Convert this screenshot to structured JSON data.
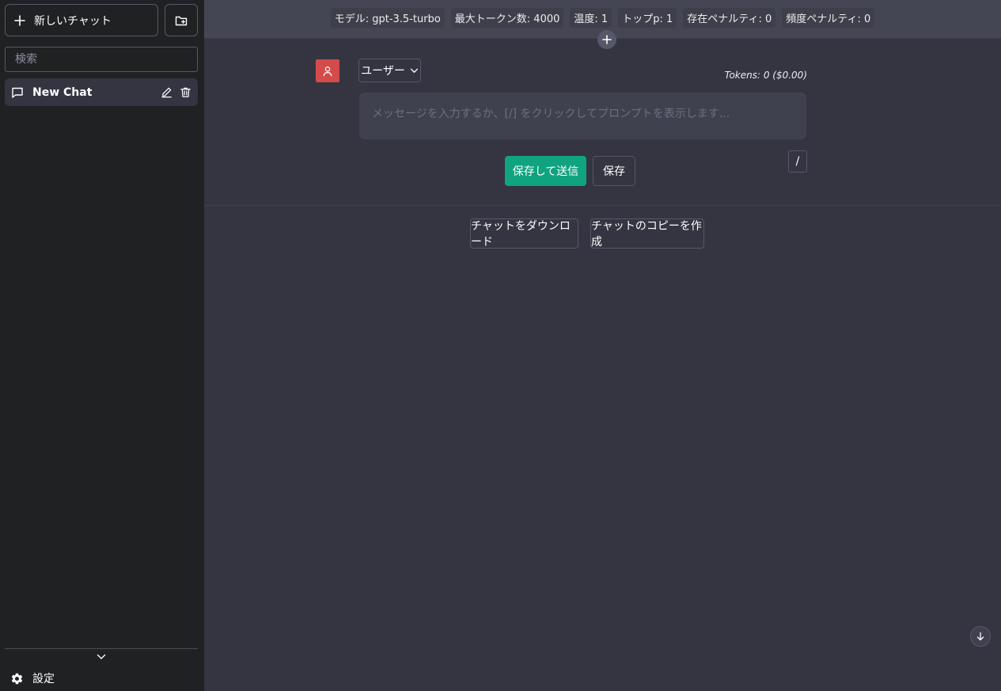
{
  "sidebar": {
    "new_chat_label": "新しいチャット",
    "search_placeholder": "検索",
    "chats": [
      {
        "title": "New Chat"
      }
    ],
    "settings_label": "設定"
  },
  "config_bar": {
    "pills": [
      "モデル: gpt-3.5-turbo",
      "最大トークン数: 4000",
      "温度: 1",
      "トップp: 1",
      "存在ペナルティ: 0",
      "頻度ペナルティ: 0"
    ]
  },
  "message": {
    "role_label": "ユーザー",
    "tokens_label": "Tokens: 0 ($0.00)",
    "input_value": "",
    "input_placeholder": "メッセージを入力するか、[/] をクリックしてプロンプトを表示します...",
    "save_submit_label": "保存して送信",
    "save_label": "保存",
    "prompt_button_label": "/"
  },
  "actions": {
    "download_label": "チャットをダウンロード",
    "clone_label": "チャットのコピーを作成"
  },
  "colors": {
    "sidebar_bg": "#202123",
    "main_bg": "#343541",
    "config_bar_bg": "#444654",
    "accent_green": "#10a37f",
    "avatar_red": "#d44b4b"
  },
  "icons": {
    "new_chat": "plus-icon",
    "new_folder": "folder-plus-icon",
    "chat_item": "message-square-icon",
    "edit": "pencil-icon",
    "delete": "trash-icon",
    "collapse": "chevron-down-icon",
    "settings": "gear-icon",
    "add_message": "plus-icon",
    "avatar": "user-icon",
    "role_dropdown": "chevron-down-icon",
    "scroll_down": "arrow-down-icon"
  }
}
